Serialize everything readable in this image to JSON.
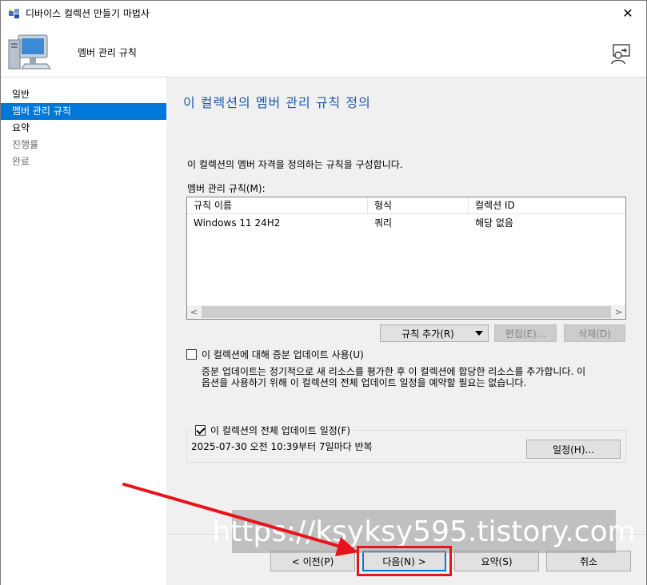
{
  "window": {
    "title": "디바이스 컬렉션 만들기 마법사",
    "close_glyph": "✕"
  },
  "header": {
    "title": "멤버 관리 규칙"
  },
  "sidebar": {
    "items": [
      {
        "label": "일반"
      },
      {
        "label": "멤버 관리 규칙"
      },
      {
        "label": "요약"
      },
      {
        "label": "진행률"
      },
      {
        "label": "완료"
      }
    ]
  },
  "main": {
    "heading": "이 컬렉션의 멤버 관리 규칙 정의",
    "description": "이 컬렉션의 멤버 자격을 정의하는 규칙을 구성합니다.",
    "rules_label": "멤버 관리 규칙(M):",
    "table": {
      "columns": [
        "규칙 이름",
        "형식",
        "컬렉션 ID"
      ],
      "rows": [
        [
          "Windows 11 24H2",
          "쿼리",
          "해당 없음"
        ]
      ]
    },
    "buttons": {
      "add_rule": "규칙 추가(R)",
      "edit": "편집(E)...",
      "delete": "삭제(D)"
    },
    "incremental": {
      "label": "이 컬렉션에 대해 증분 업데이트 사용(U)",
      "checked": false,
      "desc_line1": "증분 업데이트는 정기적으로 새 리소스를 평가한 후 이 컬렉션에 합당한 리소스를 추가합니다. 이",
      "desc_line2": "옵션을 사용하기 위해 이 컬렉션의 전체 업데이트 일정을 예약할 필요는 없습니다."
    },
    "schedule": {
      "label": "이 컬렉션의 전체 업데이트 일정(F)",
      "checked": true,
      "text": "2025-07-30 오전 10:39부터 7일마다 반복",
      "button": "일정(H)..."
    }
  },
  "footer": {
    "prev": "< 이전(P)",
    "next": "다음(N) >",
    "summary": "요약(S)",
    "cancel": "취소"
  },
  "watermark": "https://ksyksy595.tistory.com",
  "colors": {
    "accent": "#0078d7",
    "heading": "#1e5aa8",
    "annotation": "#e8131b"
  }
}
